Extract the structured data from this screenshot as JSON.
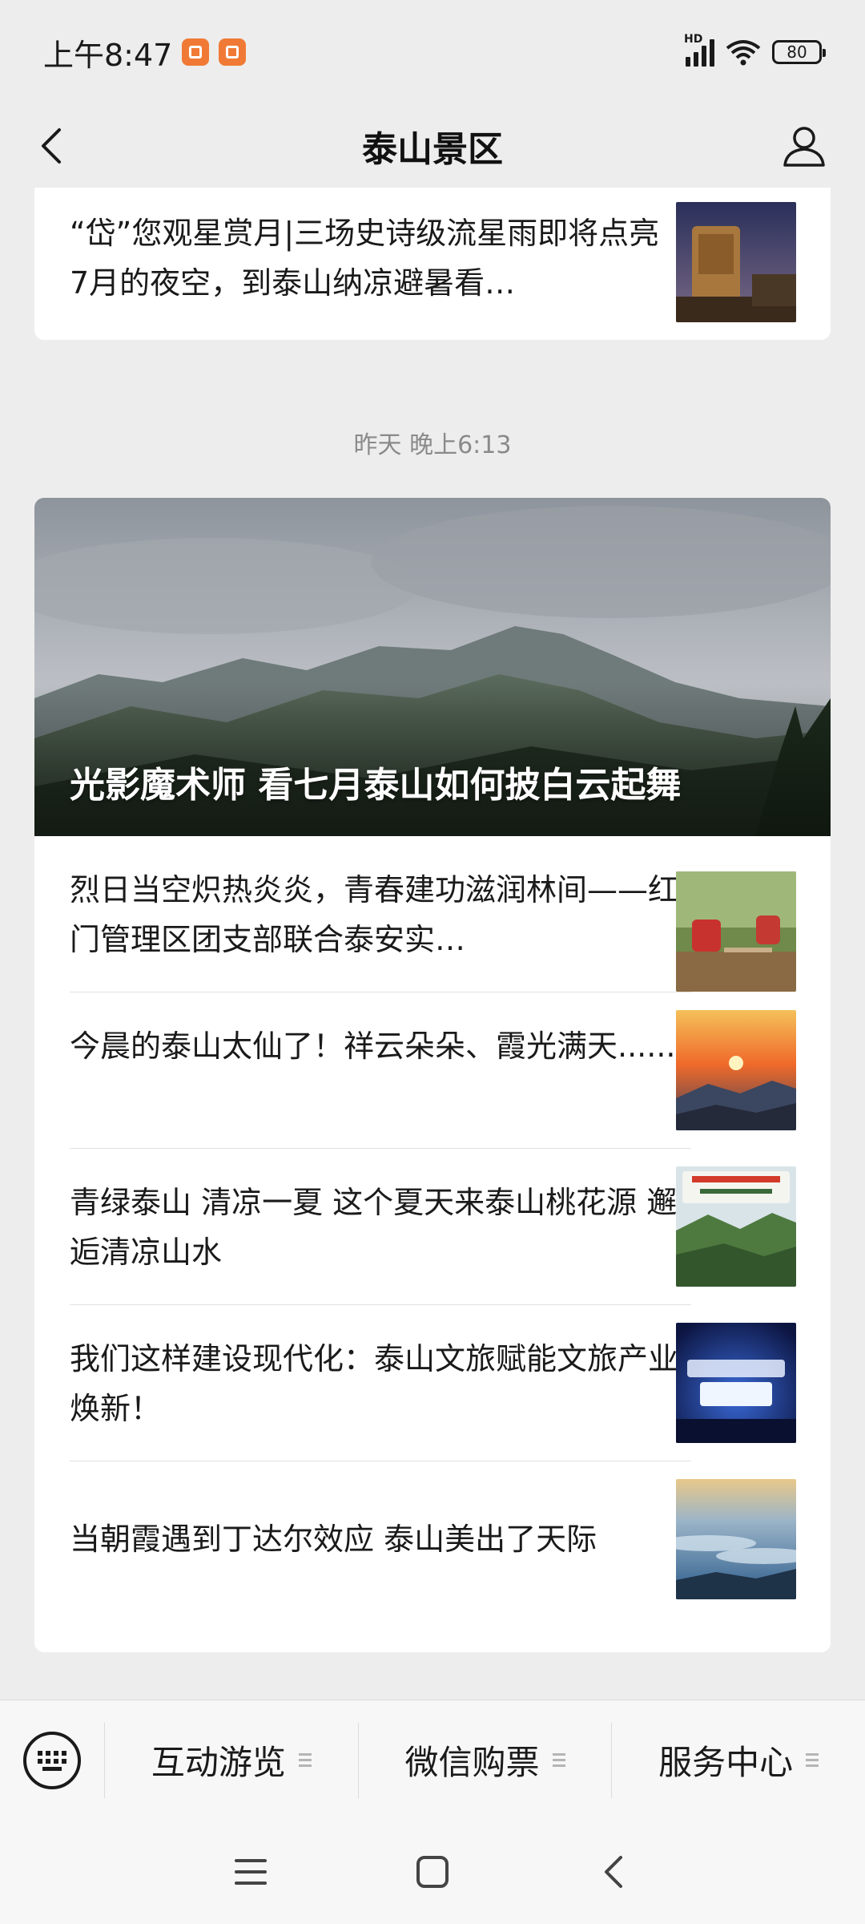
{
  "status_bar": {
    "time": "上午8:47",
    "battery": "80",
    "network": "HD"
  },
  "header": {
    "title": "泰山景区"
  },
  "top_card": {
    "article": {
      "title": "“岱”您观星赏月|三场史诗级流星雨即将点亮7月的夜空，到泰山纳凉避暑看…",
      "thumbnail": "stone-tablet-night-photo"
    }
  },
  "timestamp": "昨天 晚上6:13",
  "main_card": {
    "hero": {
      "title": "光影魔术师 看七月泰山如何披白云起舞",
      "image": "clouds-over-mountain-photo"
    },
    "articles": [
      {
        "title": "烈日当空炽热炎炎，青春建功滋润林间——红门管理区团支部联合泰安实…",
        "thumbnail": "forest-volunteers-photo"
      },
      {
        "title": "今晨的泰山太仙了！祥云朵朵、霞光满天......",
        "thumbnail": "sunrise-photo"
      },
      {
        "title": "青绿泰山 清凉一夏 这个夏天来泰山桃花源 邂逅清凉山水",
        "thumbnail": "green-valley-photo"
      },
      {
        "title": "我们这样建设现代化：泰山文旅赋能文旅产业焕新！",
        "thumbnail": "modernization-poster"
      },
      {
        "title": "当朝霞遇到丁达尔效应 泰山美出了天际",
        "thumbnail": "sea-of-clouds-photo"
      }
    ]
  },
  "bottom_menu": {
    "items": [
      {
        "label": "互动游览"
      },
      {
        "label": "微信购票"
      },
      {
        "label": "服务中心"
      }
    ]
  },
  "colors": {
    "page_background": "#ededed",
    "card_background": "#ffffff",
    "timestamp_text": "#8a8a8a"
  }
}
